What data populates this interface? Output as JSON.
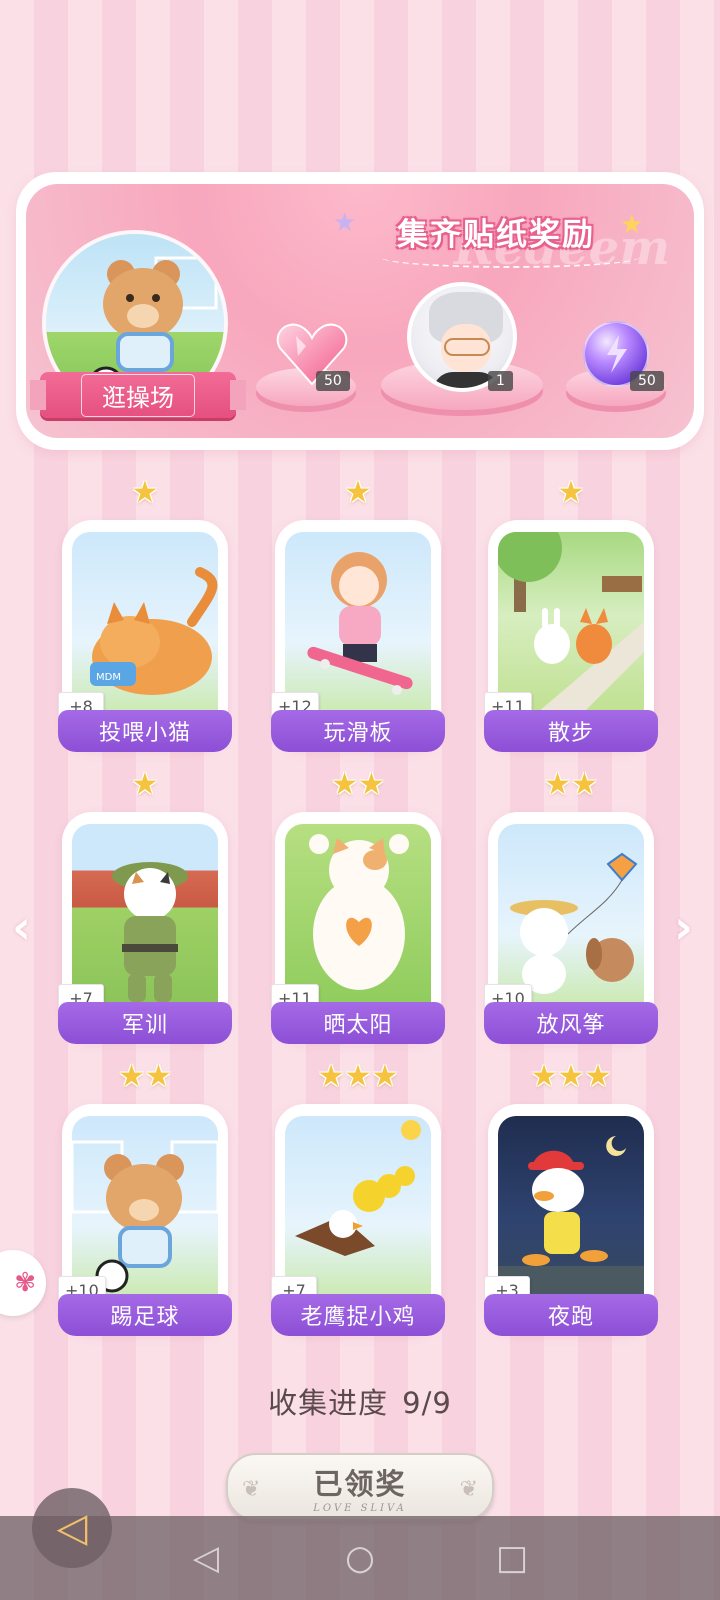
{
  "banner": {
    "title": "集齐贴纸奖励",
    "watermark": "Redeem",
    "location": "逛操场",
    "rewards": [
      {
        "icon": "heart-gem-icon",
        "count": "50"
      },
      {
        "icon": "character-avatar",
        "count": "1"
      },
      {
        "icon": "energy-orb-icon",
        "count": "50"
      }
    ]
  },
  "cards": [
    {
      "label": "投喂小猫",
      "bonus": "+8",
      "stars": 1,
      "image": "cat-eating-illustration"
    },
    {
      "label": "玩滑板",
      "bonus": "+12",
      "stars": 1,
      "image": "girl-skateboard-illustration"
    },
    {
      "label": "散步",
      "bonus": "+11",
      "stars": 1,
      "image": "rabbit-fox-walk-illustration"
    },
    {
      "label": "军训",
      "bonus": "+7",
      "stars": 1,
      "image": "cat-military-illustration"
    },
    {
      "label": "晒太阳",
      "bonus": "+11",
      "stars": 2,
      "image": "cat-sunbathing-illustration"
    },
    {
      "label": "放风筝",
      "bonus": "+10",
      "stars": 2,
      "image": "rabbit-kite-illustration"
    },
    {
      "label": "踢足球",
      "bonus": "+10",
      "stars": 2,
      "image": "bear-soccer-illustration"
    },
    {
      "label": "老鹰捉小鸡",
      "bonus": "+7",
      "stars": 3,
      "image": "eagle-chicks-illustration"
    },
    {
      "label": "夜跑",
      "bonus": "+3",
      "stars": 3,
      "image": "duck-night-run-illustration"
    }
  ],
  "progress": {
    "label": "收集进度",
    "value": "9/9"
  },
  "claim": {
    "label": "已领奖",
    "sub": "LOVE SLIVA"
  },
  "colors": {
    "accent_pink": "#e8618e",
    "label_purple": "#9a5ddf",
    "star_gold": "#f6c33f"
  }
}
